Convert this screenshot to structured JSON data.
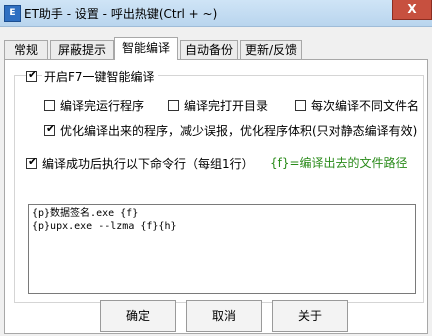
{
  "window": {
    "title": "ET助手 - 设置 - 呼出热键(Ctrl + ~)",
    "app_icon_text": "E",
    "close_glyph": "X"
  },
  "tabs": [
    {
      "label": "常规"
    },
    {
      "label": "屏蔽提示"
    },
    {
      "label": "智能编译",
      "active": true
    },
    {
      "label": "自动备份"
    },
    {
      "label": "更新/反馈"
    }
  ],
  "smart_compile": {
    "enable": {
      "label": "开启F7一键智能编译",
      "checked": true
    },
    "options": [
      {
        "label": "编译完运行程序",
        "checked": false
      },
      {
        "label": "编译完打开目录",
        "checked": false
      },
      {
        "label": "每次编译不同文件名",
        "checked": false
      },
      {
        "label": "优化编译出来的程序，减少误报，优化程序体积(只对静态编译有效)",
        "checked": true
      }
    ],
    "post_commands": {
      "label": "编译成功后执行以下命令行（每组1行）",
      "checked": true
    },
    "hint": "{f}=编译出去的文件路径",
    "commands": [
      "{p}数据签名.exe {f}",
      "{p}upx.exe --lzma {f}{h}"
    ]
  },
  "buttons": {
    "ok": "确定",
    "cancel": "取消",
    "about": "关于"
  },
  "colors": {
    "hint": "#2a8b1a",
    "close": "#c7503f",
    "titlebar": "#cfe4f6"
  }
}
